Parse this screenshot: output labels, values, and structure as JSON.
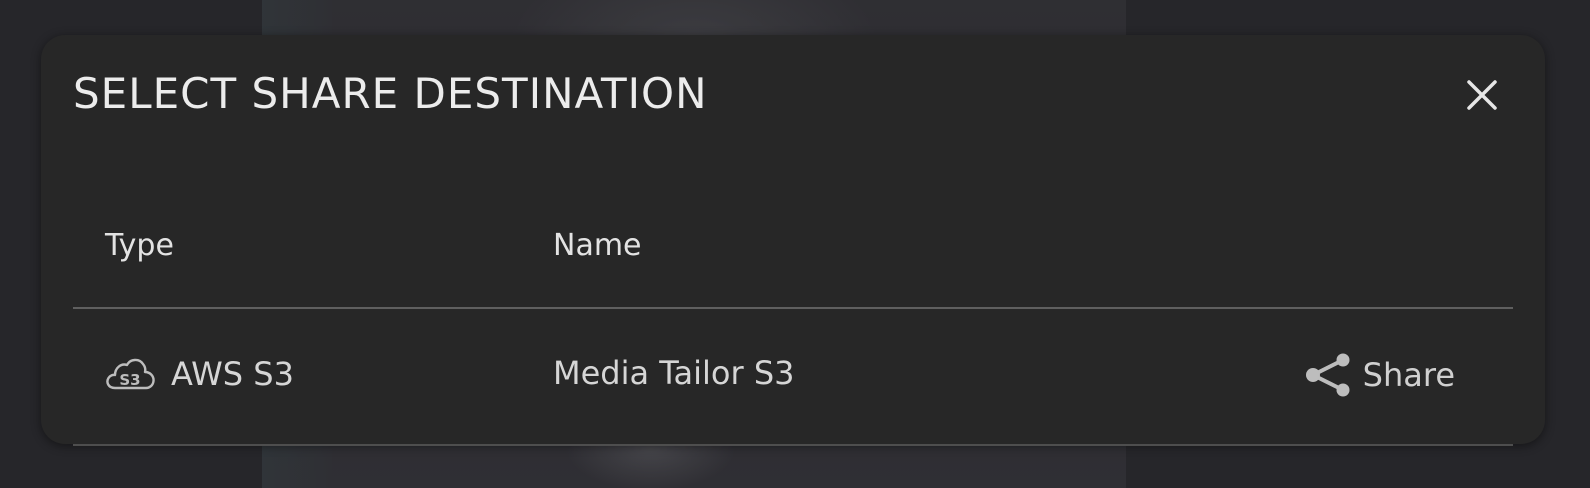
{
  "dialog": {
    "title": "SELECT SHARE DESTINATION",
    "close_icon": "close-icon"
  },
  "table": {
    "columns": [
      "Type",
      "Name"
    ],
    "rows": [
      {
        "type_icon": "aws-s3-cloud-icon",
        "type": "AWS S3",
        "name": "Media Tailor S3",
        "action_icon": "share-icon",
        "action_label": "Share"
      }
    ]
  },
  "colors": {
    "modal_background": "#272727",
    "page_background": "#2c2b2f",
    "text_primary": "#ececec",
    "divider": "#5f5f5f"
  }
}
